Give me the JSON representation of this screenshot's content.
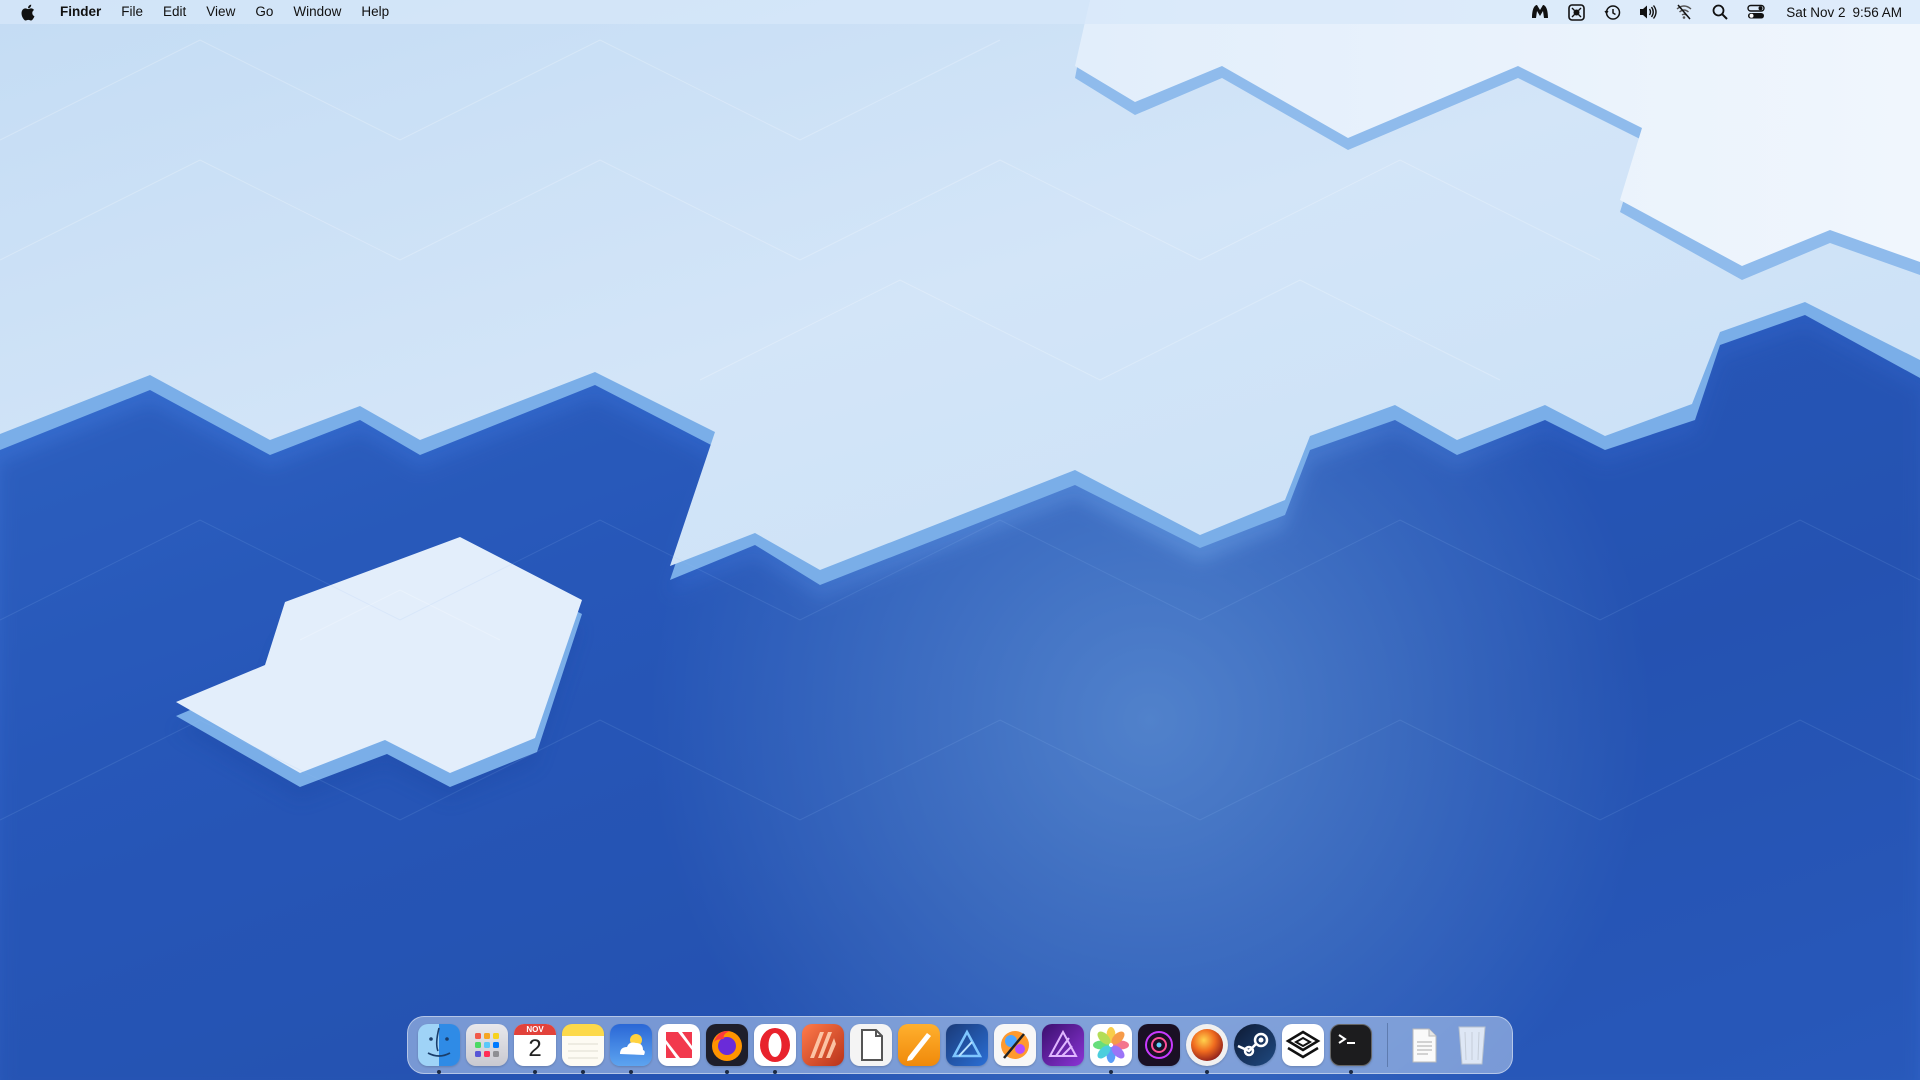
{
  "menubar": {
    "apple_icon": "apple-logo-icon",
    "app_name": "Finder",
    "menus": [
      "File",
      "Edit",
      "View",
      "Go",
      "Window",
      "Help"
    ],
    "status_icons": [
      "malwarebytes-icon",
      "screen-share-icon",
      "time-machine-icon",
      "volume-icon",
      "wifi-off-icon",
      "spotlight-search-icon",
      "control-center-icon"
    ],
    "clock": {
      "date": "Sat Nov 2",
      "time": "9:56 AM"
    }
  },
  "dock": {
    "apps": [
      {
        "name": "Finder",
        "icon": "finder-icon",
        "running": true
      },
      {
        "name": "Launchpad",
        "icon": "launchpad-icon",
        "running": false
      },
      {
        "name": "Calendar",
        "icon": "calendar-icon",
        "running": true,
        "month": "NOV",
        "day": "2"
      },
      {
        "name": "Notes",
        "icon": "notes-icon",
        "running": true
      },
      {
        "name": "Weather",
        "icon": "weather-icon",
        "running": true
      },
      {
        "name": "News",
        "icon": "news-icon",
        "running": false
      },
      {
        "name": "Firefox",
        "icon": "firefox-icon",
        "running": true
      },
      {
        "name": "Opera",
        "icon": "opera-icon",
        "running": true
      },
      {
        "name": "Affinity Publisher",
        "icon": "affinity-publisher-icon",
        "running": false
      },
      {
        "name": "Preview",
        "icon": "preview-icon",
        "running": false
      },
      {
        "name": "Pages",
        "icon": "pages-icon",
        "running": false
      },
      {
        "name": "Affinity Designer",
        "icon": "affinity-designer-icon",
        "running": false
      },
      {
        "name": "Pixelmator",
        "icon": "pixelmator-icon",
        "running": false
      },
      {
        "name": "Affinity Photo",
        "icon": "affinity-photo-icon",
        "running": false
      },
      {
        "name": "Photos",
        "icon": "photos-icon",
        "running": true
      },
      {
        "name": "DaVinci Resolve",
        "icon": "davinci-resolve-icon",
        "running": false
      },
      {
        "name": "macOS Sequoia",
        "icon": "macos-installer-icon",
        "running": true
      },
      {
        "name": "Steam",
        "icon": "steam-icon",
        "running": false
      },
      {
        "name": "Parallels",
        "icon": "parallels-icon",
        "running": false
      },
      {
        "name": "Terminal",
        "icon": "terminal-icon",
        "running": true
      }
    ],
    "others": [
      {
        "name": "Documents",
        "icon": "documents-stack-icon"
      },
      {
        "name": "Trash",
        "icon": "trash-icon"
      }
    ],
    "calendar_month": "NOV",
    "calendar_day": "2"
  },
  "colors": {
    "wallpaper_deep": "#2d5fc3",
    "wallpaper_ice": "#d5e6f8",
    "wallpaper_edge": "#7aaee8"
  }
}
